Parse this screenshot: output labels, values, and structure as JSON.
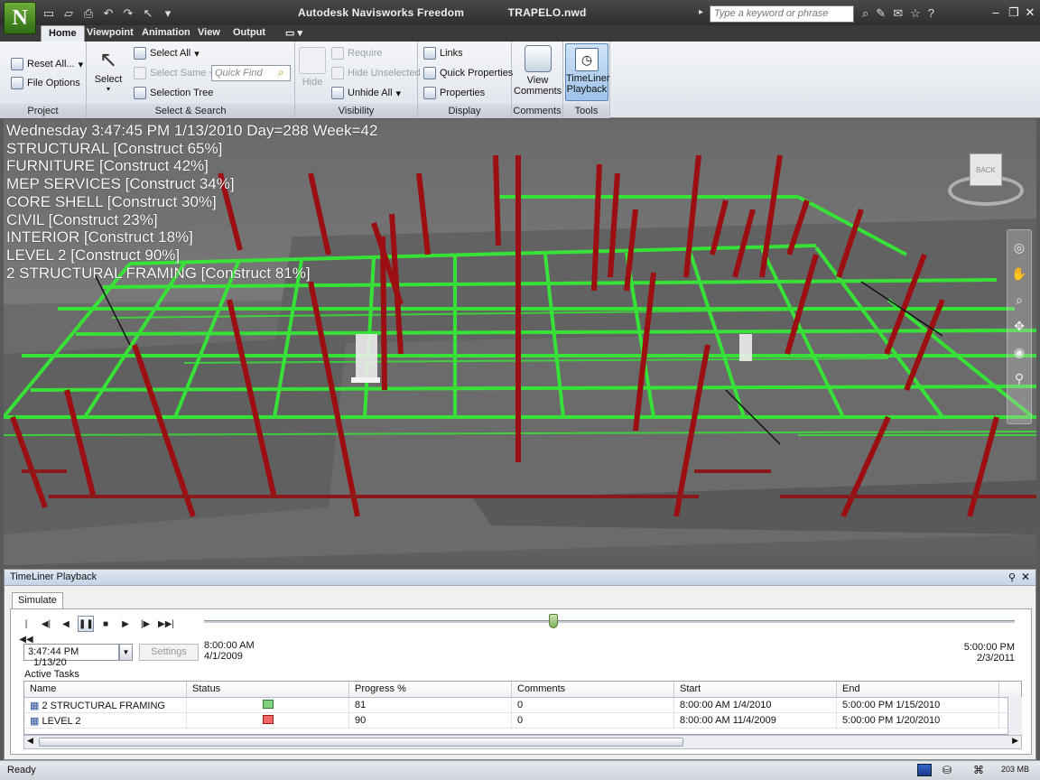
{
  "window": {
    "app_title": "Autodesk Navisworks Freedom",
    "document": "TRAPELO.nwd",
    "search_placeholder": "Type a keyword or phrase"
  },
  "tabs": [
    "Home",
    "Viewpoint",
    "Animation",
    "View",
    "Output"
  ],
  "ribbon": {
    "project": {
      "label": "Project",
      "reset_all": "Reset All...",
      "file_options": "File Options"
    },
    "select_search": {
      "label": "Select & Search",
      "select": "Select",
      "select_all": "Select All",
      "select_same": "Select Same",
      "selection_tree": "Selection Tree",
      "quick_find_placeholder": "Quick Find"
    },
    "visibility": {
      "label": "Visibility",
      "hide": "Hide",
      "require": "Require",
      "hide_unselected": "Hide Unselected",
      "unhide_all": "Unhide All"
    },
    "display": {
      "label": "Display",
      "links": "Links",
      "quick_properties": "Quick Properties",
      "properties": "Properties"
    },
    "comments": {
      "label": "Comments",
      "view_comments_1": "View",
      "view_comments_2": "Comments"
    },
    "tools": {
      "label": "Tools",
      "timeliner_1": "TimeLiner",
      "timeliner_2": "Playback"
    }
  },
  "viewport": {
    "overlay_lines": [
      "Wednesday 3:47:45 PM 1/13/2010 Day=288 Week=42",
      "STRUCTURAL [Construct 65%]",
      "FURNITURE [Construct 42%]",
      "MEP SERVICES [Construct 34%]",
      "CORE SHELL [Construct 30%]",
      "CIVIL [Construct 23%]",
      "INTERIOR [Construct 18%]",
      "LEVEL 2 [Construct 90%]",
      "2 STRUCTURAL FRAMING [Construct 81%]"
    ],
    "viewcube_face": "BACK"
  },
  "timeliner": {
    "title": "TimeLiner Playback",
    "subtab": "Simulate",
    "current_time": "3:47:44 PM",
    "current_date": "1/13/20",
    "settings_label": "Settings",
    "start_time": "8:00:00 AM",
    "start_date": "4/1/2009",
    "end_time": "5:00:00 PM",
    "end_date": "2/3/2011",
    "slider_position_fraction": 0.43,
    "active_tasks_label": "Active Tasks",
    "columns": [
      "Name",
      "Status",
      "Progress %",
      "Comments",
      "Start",
      "End"
    ],
    "rows": [
      {
        "name": "2 STRUCTURAL FRAMING",
        "progress": "81",
        "comments": "0",
        "start": "8:00:00 AM 1/4/2010",
        "end": "5:00:00 PM 1/15/2010"
      },
      {
        "name": "LEVEL 2",
        "progress": "90",
        "comments": "0",
        "start": "8:00:00 AM 11/4/2009",
        "end": "5:00:00 PM 1/20/2010"
      }
    ]
  },
  "status": {
    "ready": "Ready",
    "memory": "203 MB"
  }
}
